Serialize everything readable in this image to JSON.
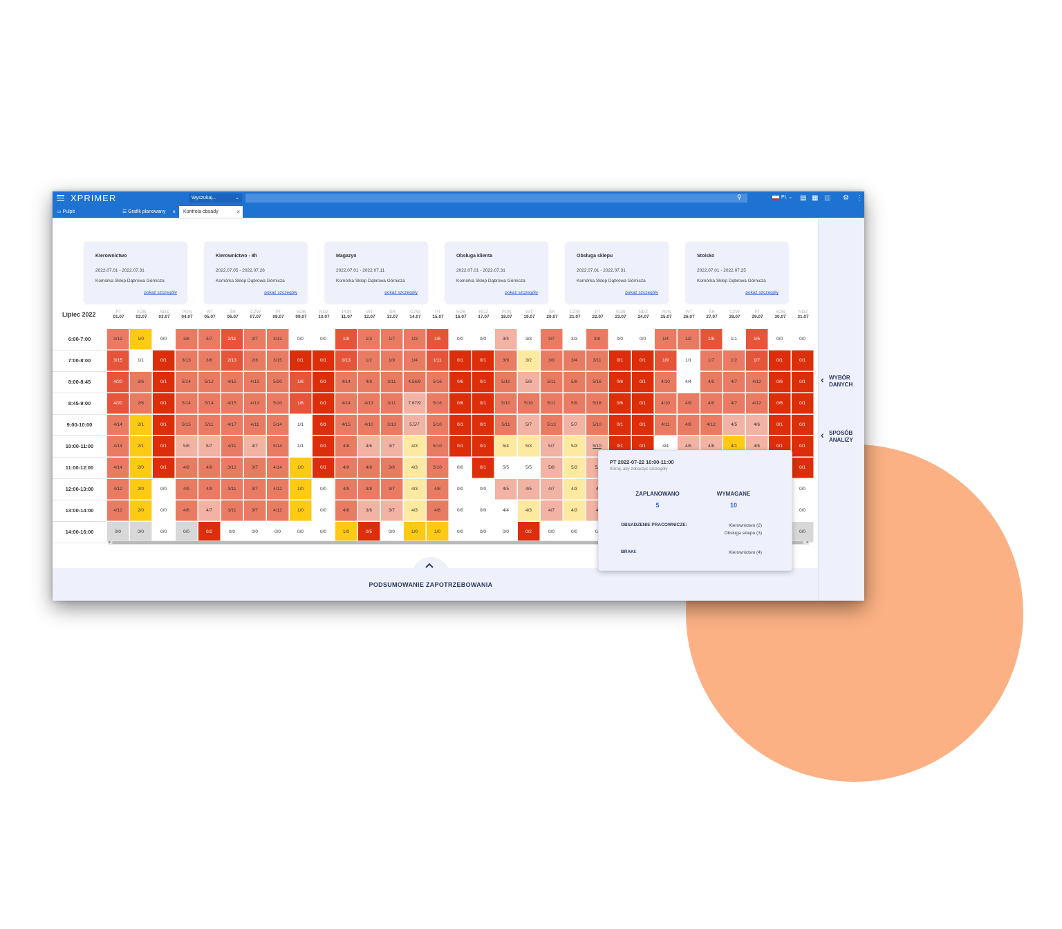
{
  "app": {
    "logo": "XPRIMER",
    "search_placeholder": "Wyszukaj...",
    "lang": "PL"
  },
  "tabs": [
    {
      "label": "Pulpit"
    },
    {
      "label": "Grafik planowany"
    },
    {
      "label": "Kontrola obsady"
    }
  ],
  "right_panel": {
    "data_choice": "WYBÓR DANYCH",
    "analysis_mode": "SPOSÓB ANALIZY"
  },
  "cards": [
    {
      "title": "Kierownictwo",
      "dates": "2022.07.01 - 2022.07.31",
      "cell": "Komórka Sklep Dąbrowa Górnicza",
      "link": "pokaż szczegóły"
    },
    {
      "title": "Kierownictwo - 8h",
      "dates": "2022.07.05 - 2022.07.26",
      "cell": "Komórka Sklep Dąbrowa Górnicza",
      "link": "pokaż szczegóły"
    },
    {
      "title": "Magazyn",
      "dates": "2022.07.01 - 2022.07.11",
      "cell": "Komórka Sklep Dąbrowa Górnicza",
      "link": "pokaż szczegóły"
    },
    {
      "title": "Obsługa klienta",
      "dates": "2022.07.01 - 2022.07.31",
      "cell": "Komórka Sklep Dąbrowa Górnicza",
      "link": "pokaż szczegóły"
    },
    {
      "title": "Obsługa sklepu",
      "dates": "2022.07.01 - 2022.07.31",
      "cell": "Komórka Sklep Dąbrowa Górnicza",
      "link": "pokaż szczegóły"
    },
    {
      "title": "Stoisko",
      "dates": "2022.07.01 - 2022.07.25",
      "cell": "Komórka Sklep Dąbrowa Górnicza",
      "link": "pokaż szczegóły"
    }
  ],
  "grid": {
    "month": "Lipiec 2022",
    "days": [
      {
        "n": "PT",
        "d": "01.07"
      },
      {
        "n": "SOB",
        "d": "02.07"
      },
      {
        "n": "NDZ",
        "d": "03.07"
      },
      {
        "n": "PON",
        "d": "04.07"
      },
      {
        "n": "WT",
        "d": "05.07"
      },
      {
        "n": "ŚR",
        "d": "06.07"
      },
      {
        "n": "CZW",
        "d": "07.07"
      },
      {
        "n": "PT",
        "d": "08.07"
      },
      {
        "n": "SOB",
        "d": "09.07"
      },
      {
        "n": "NDZ",
        "d": "10.07"
      },
      {
        "n": "PON",
        "d": "11.07"
      },
      {
        "n": "WT",
        "d": "12.07"
      },
      {
        "n": "ŚR",
        "d": "13.07"
      },
      {
        "n": "CZW",
        "d": "14.07"
      },
      {
        "n": "PT",
        "d": "15.07"
      },
      {
        "n": "SOB",
        "d": "16.07"
      },
      {
        "n": "NDZ",
        "d": "17.07"
      },
      {
        "n": "PON",
        "d": "18.07"
      },
      {
        "n": "WT",
        "d": "19.07"
      },
      {
        "n": "ŚR",
        "d": "20.07"
      },
      {
        "n": "CZW",
        "d": "21.07"
      },
      {
        "n": "PT",
        "d": "22.07"
      },
      {
        "n": "SOB",
        "d": "23.07"
      },
      {
        "n": "NDZ",
        "d": "24.07"
      },
      {
        "n": "PON",
        "d": "25.07"
      },
      {
        "n": "WT",
        "d": "26.07"
      },
      {
        "n": "ŚR",
        "d": "27.07"
      },
      {
        "n": "CZW",
        "d": "28.07"
      },
      {
        "n": "PT",
        "d": "29.07"
      },
      {
        "n": "SOB",
        "d": "30.07"
      },
      {
        "n": "NDZ",
        "d": "31.07"
      }
    ],
    "legend_colors": {
      "r": "#dc2e0b",
      "o": "#e6553a",
      "s": "#ea7b63",
      "p": "#f2b2a4",
      "y": "#ffca14",
      "l": "#fde9a0",
      "w": "#ffffff",
      "g": "#d8d8d8"
    },
    "rows": [
      {
        "time": "6:00-7:00",
        "cells": [
          "3/12",
          "1/0",
          "0/0",
          "3/8",
          "3/7",
          "2/11",
          "2/7",
          "3/12",
          "0/0",
          "0/0",
          "1/8",
          "1/3",
          "1/7",
          "1/3",
          "1/8",
          "0/0",
          "0/0",
          "3/4",
          "3/3",
          "3/7",
          "3/3",
          "3/8",
          "0/0",
          "0/0",
          "1/4",
          "1/2",
          "1/6",
          "1/1",
          "1/6",
          "0/0",
          "0/0"
        ],
        "colors": [
          "s",
          "y",
          "w",
          "s",
          "s",
          "o",
          "s",
          "s",
          "w",
          "w",
          "o",
          "s",
          "s",
          "s",
          "o",
          "w",
          "w",
          "p",
          "w",
          "s",
          "w",
          "s",
          "w",
          "w",
          "s",
          "s",
          "o",
          "w",
          "o",
          "w",
          "w"
        ]
      },
      {
        "time": "7:00-8:00",
        "cells": [
          "3/15",
          "1/1",
          "0/1",
          "3/13",
          "3/6",
          "2/13",
          "2/8",
          "3/15",
          "0/1",
          "0/1",
          "1/13",
          "1/2",
          "1/9",
          "1/4",
          "1/11",
          "0/1",
          "0/1",
          "3/9",
          "3/2",
          "3/9",
          "3/4",
          "3/11",
          "0/1",
          "0/1",
          "1/9",
          "1/1",
          "1/7",
          "1/2",
          "1/7",
          "0/1",
          "0/1"
        ],
        "colors": [
          "o",
          "w",
          "r",
          "s",
          "s",
          "o",
          "s",
          "s",
          "r",
          "r",
          "o",
          "s",
          "s",
          "s",
          "o",
          "r",
          "r",
          "s",
          "l",
          "s",
          "s",
          "s",
          "r",
          "r",
          "o",
          "w",
          "s",
          "s",
          "o",
          "r",
          "r"
        ]
      },
      {
        "time": "8:00-8:45",
        "cells": [
          "4/20",
          "2/6",
          "0/1",
          "5/14",
          "5/12",
          "4/15",
          "4/13",
          "5/20",
          "1/6",
          "0/1",
          "4/14",
          "4/8",
          "3/11",
          "4.56/9",
          "5/16",
          "0/6",
          "0/1",
          "5/10",
          "5/8",
          "5/11",
          "5/9",
          "5/16",
          "0/6",
          "0/1",
          "4/10",
          "4/4",
          "4/9",
          "4/7",
          "4/12",
          "0/6",
          "0/1"
        ],
        "colors": [
          "o",
          "s",
          "r",
          "s",
          "s",
          "s",
          "s",
          "s",
          "o",
          "r",
          "s",
          "s",
          "s",
          "s",
          "s",
          "r",
          "r",
          "s",
          "p",
          "s",
          "s",
          "s",
          "r",
          "r",
          "s",
          "w",
          "s",
          "s",
          "s",
          "r",
          "r"
        ]
      },
      {
        "time": "8:45-9:00",
        "cells": [
          "4/20",
          "2/6",
          "0/1",
          "5/14",
          "5/14",
          "4/15",
          "4/13",
          "5/20",
          "1/6",
          "0/1",
          "4/14",
          "4/13",
          "3/11",
          "7.67/9",
          "5/16",
          "0/6",
          "0/1",
          "5/10",
          "5/10",
          "5/11",
          "5/9",
          "5/16",
          "0/6",
          "0/1",
          "4/10",
          "4/9",
          "4/9",
          "4/7",
          "4/12",
          "0/6",
          "0/1"
        ],
        "colors": [
          "o",
          "s",
          "r",
          "s",
          "s",
          "s",
          "s",
          "s",
          "o",
          "r",
          "s",
          "s",
          "s",
          "p",
          "s",
          "r",
          "r",
          "s",
          "s",
          "s",
          "s",
          "s",
          "r",
          "r",
          "s",
          "s",
          "s",
          "s",
          "s",
          "r",
          "r"
        ]
      },
      {
        "time": "9:00-10:00",
        "cells": [
          "4/14",
          "2/1",
          "0/1",
          "5/15",
          "5/11",
          "4/17",
          "4/11",
          "5/14",
          "1/1",
          "0/1",
          "4/15",
          "4/10",
          "3/13",
          "5.5/7",
          "5/10",
          "0/1",
          "0/1",
          "5/11",
          "5/7",
          "5/13",
          "5/7",
          "5/10",
          "0/1",
          "0/1",
          "4/11",
          "4/9",
          "4/12",
          "4/5",
          "4/6",
          "0/1",
          "0/1"
        ],
        "colors": [
          "s",
          "y",
          "r",
          "s",
          "s",
          "s",
          "s",
          "s",
          "w",
          "r",
          "s",
          "s",
          "s",
          "p",
          "s",
          "r",
          "r",
          "s",
          "p",
          "s",
          "p",
          "s",
          "r",
          "r",
          "s",
          "s",
          "s",
          "p",
          "p",
          "r",
          "r"
        ]
      },
      {
        "time": "10:00-11:00",
        "cells": [
          "4/14",
          "2/1",
          "0/1",
          "5/8",
          "5/7",
          "4/11",
          "4/7",
          "5/14",
          "1/1",
          "0/1",
          "4/8",
          "4/6",
          "3/7",
          "4/3",
          "5/10",
          "0/1",
          "0/1",
          "5/4",
          "5/3",
          "5/7",
          "5/3",
          "5/10",
          "0/1",
          "0/1",
          "4/4",
          "4/5",
          "4/6",
          "4/1",
          "4/6",
          "0/1",
          "0/1"
        ],
        "colors": [
          "s",
          "y",
          "r",
          "p",
          "p",
          "s",
          "p",
          "s",
          "w",
          "r",
          "s",
          "p",
          "p",
          "l",
          "s",
          "r",
          "r",
          "l",
          "l",
          "p",
          "l",
          "p",
          "r",
          "r",
          "w",
          "p",
          "p",
          "y",
          "p",
          "r",
          "r"
        ]
      },
      {
        "time": "11:00-12:00",
        "cells": [
          "4/14",
          "2/0",
          "0/1",
          "4/9",
          "4/9",
          "3/12",
          "3/7",
          "4/14",
          "1/0",
          "0/1",
          "4/9",
          "4/8",
          "3/8",
          "4/3",
          "5/10",
          "0/0",
          "0/1",
          "5/5",
          "5/5",
          "5/8",
          "5/3",
          "5/",
          "",
          "",
          "",
          "",
          "",
          "",
          "",
          "",
          "0/1"
        ],
        "colors": [
          "s",
          "y",
          "r",
          "s",
          "s",
          "s",
          "s",
          "s",
          "y",
          "r",
          "s",
          "s",
          "s",
          "l",
          "s",
          "w",
          "r",
          "w",
          "w",
          "p",
          "l",
          "p",
          "w",
          "w",
          "w",
          "w",
          "w",
          "w",
          "w",
          "w",
          "r"
        ]
      },
      {
        "time": "12:00-13:00",
        "cells": [
          "4/12",
          "2/0",
          "0/0",
          "4/9",
          "4/9",
          "3/11",
          "3/7",
          "4/12",
          "1/0",
          "0/0",
          "4/9",
          "3/8",
          "3/7",
          "4/3",
          "4/8",
          "0/0",
          "0/0",
          "4/5",
          "4/5",
          "4/7",
          "4/3",
          "4",
          "",
          "",
          "",
          "",
          "",
          "",
          "",
          "",
          "0/0"
        ],
        "colors": [
          "s",
          "y",
          "w",
          "s",
          "s",
          "s",
          "s",
          "s",
          "y",
          "w",
          "s",
          "s",
          "s",
          "l",
          "s",
          "w",
          "w",
          "p",
          "p",
          "p",
          "l",
          "p",
          "w",
          "w",
          "w",
          "w",
          "w",
          "w",
          "w",
          "w",
          "w"
        ]
      },
      {
        "time": "13:00-14:00",
        "cells": [
          "4/12",
          "2/0",
          "0/0",
          "4/8",
          "4/7",
          "3/11",
          "3/7",
          "4/12",
          "1/0",
          "0/0",
          "4/8",
          "3/6",
          "3/7",
          "4/3",
          "4/8",
          "0/0",
          "0/0",
          "4/4",
          "4/3",
          "4/7",
          "4/3",
          "4",
          "",
          "",
          "",
          "",
          "",
          "",
          "",
          "",
          "0/0"
        ],
        "colors": [
          "s",
          "y",
          "w",
          "s",
          "p",
          "s",
          "s",
          "s",
          "y",
          "w",
          "s",
          "p",
          "p",
          "l",
          "s",
          "w",
          "w",
          "w",
          "l",
          "p",
          "l",
          "p",
          "w",
          "w",
          "w",
          "w",
          "w",
          "w",
          "w",
          "w",
          "w"
        ]
      },
      {
        "time": "14:00-16:00",
        "cells": [
          "0/0",
          "0/0",
          "0/0",
          "0/0",
          "0/2",
          "0/0",
          "0/0",
          "0/0",
          "0/0",
          "0/0",
          "1/0",
          "0/5",
          "0/0",
          "1/0",
          "1/0",
          "0/0",
          "0/0",
          "0/0",
          "0/2",
          "0/0",
          "0/0",
          "0/",
          "",
          "",
          "",
          "",
          "",
          "",
          "",
          "",
          "0/0"
        ],
        "colors": [
          "g",
          "g",
          "w",
          "g",
          "r",
          "w",
          "w",
          "w",
          "w",
          "w",
          "y",
          "r",
          "w",
          "y",
          "y",
          "w",
          "w",
          "w",
          "r",
          "w",
          "w",
          "w",
          "w",
          "w",
          "w",
          "w",
          "w",
          "w",
          "w",
          "w",
          "g"
        ]
      }
    ]
  },
  "tooltip": {
    "header": "PT  2022-07-22   10:00-11:00",
    "sub": "Kliknij, aby zobaczyć szczegóły",
    "planned_label": "ZAPLANOWANO",
    "planned_value": "5",
    "required_label": "WYMAGANE",
    "required_value": "10",
    "staffing_label": "OBSADZENIE PRACOWNICZE:",
    "staffing_1": "Kierownictwo (2)",
    "staffing_2": "Obsługa sklepu (3)",
    "shortage_label": "BRAKI:",
    "shortage_value": "Kierownictwo (4)"
  },
  "summary": {
    "label": "PODSUMOWANIE ZAPOTRZEBOWANIA"
  },
  "icons": {
    "menu": "menu-icon",
    "search": "search-icon",
    "settings": "gear-icon",
    "more": "more-icon"
  }
}
